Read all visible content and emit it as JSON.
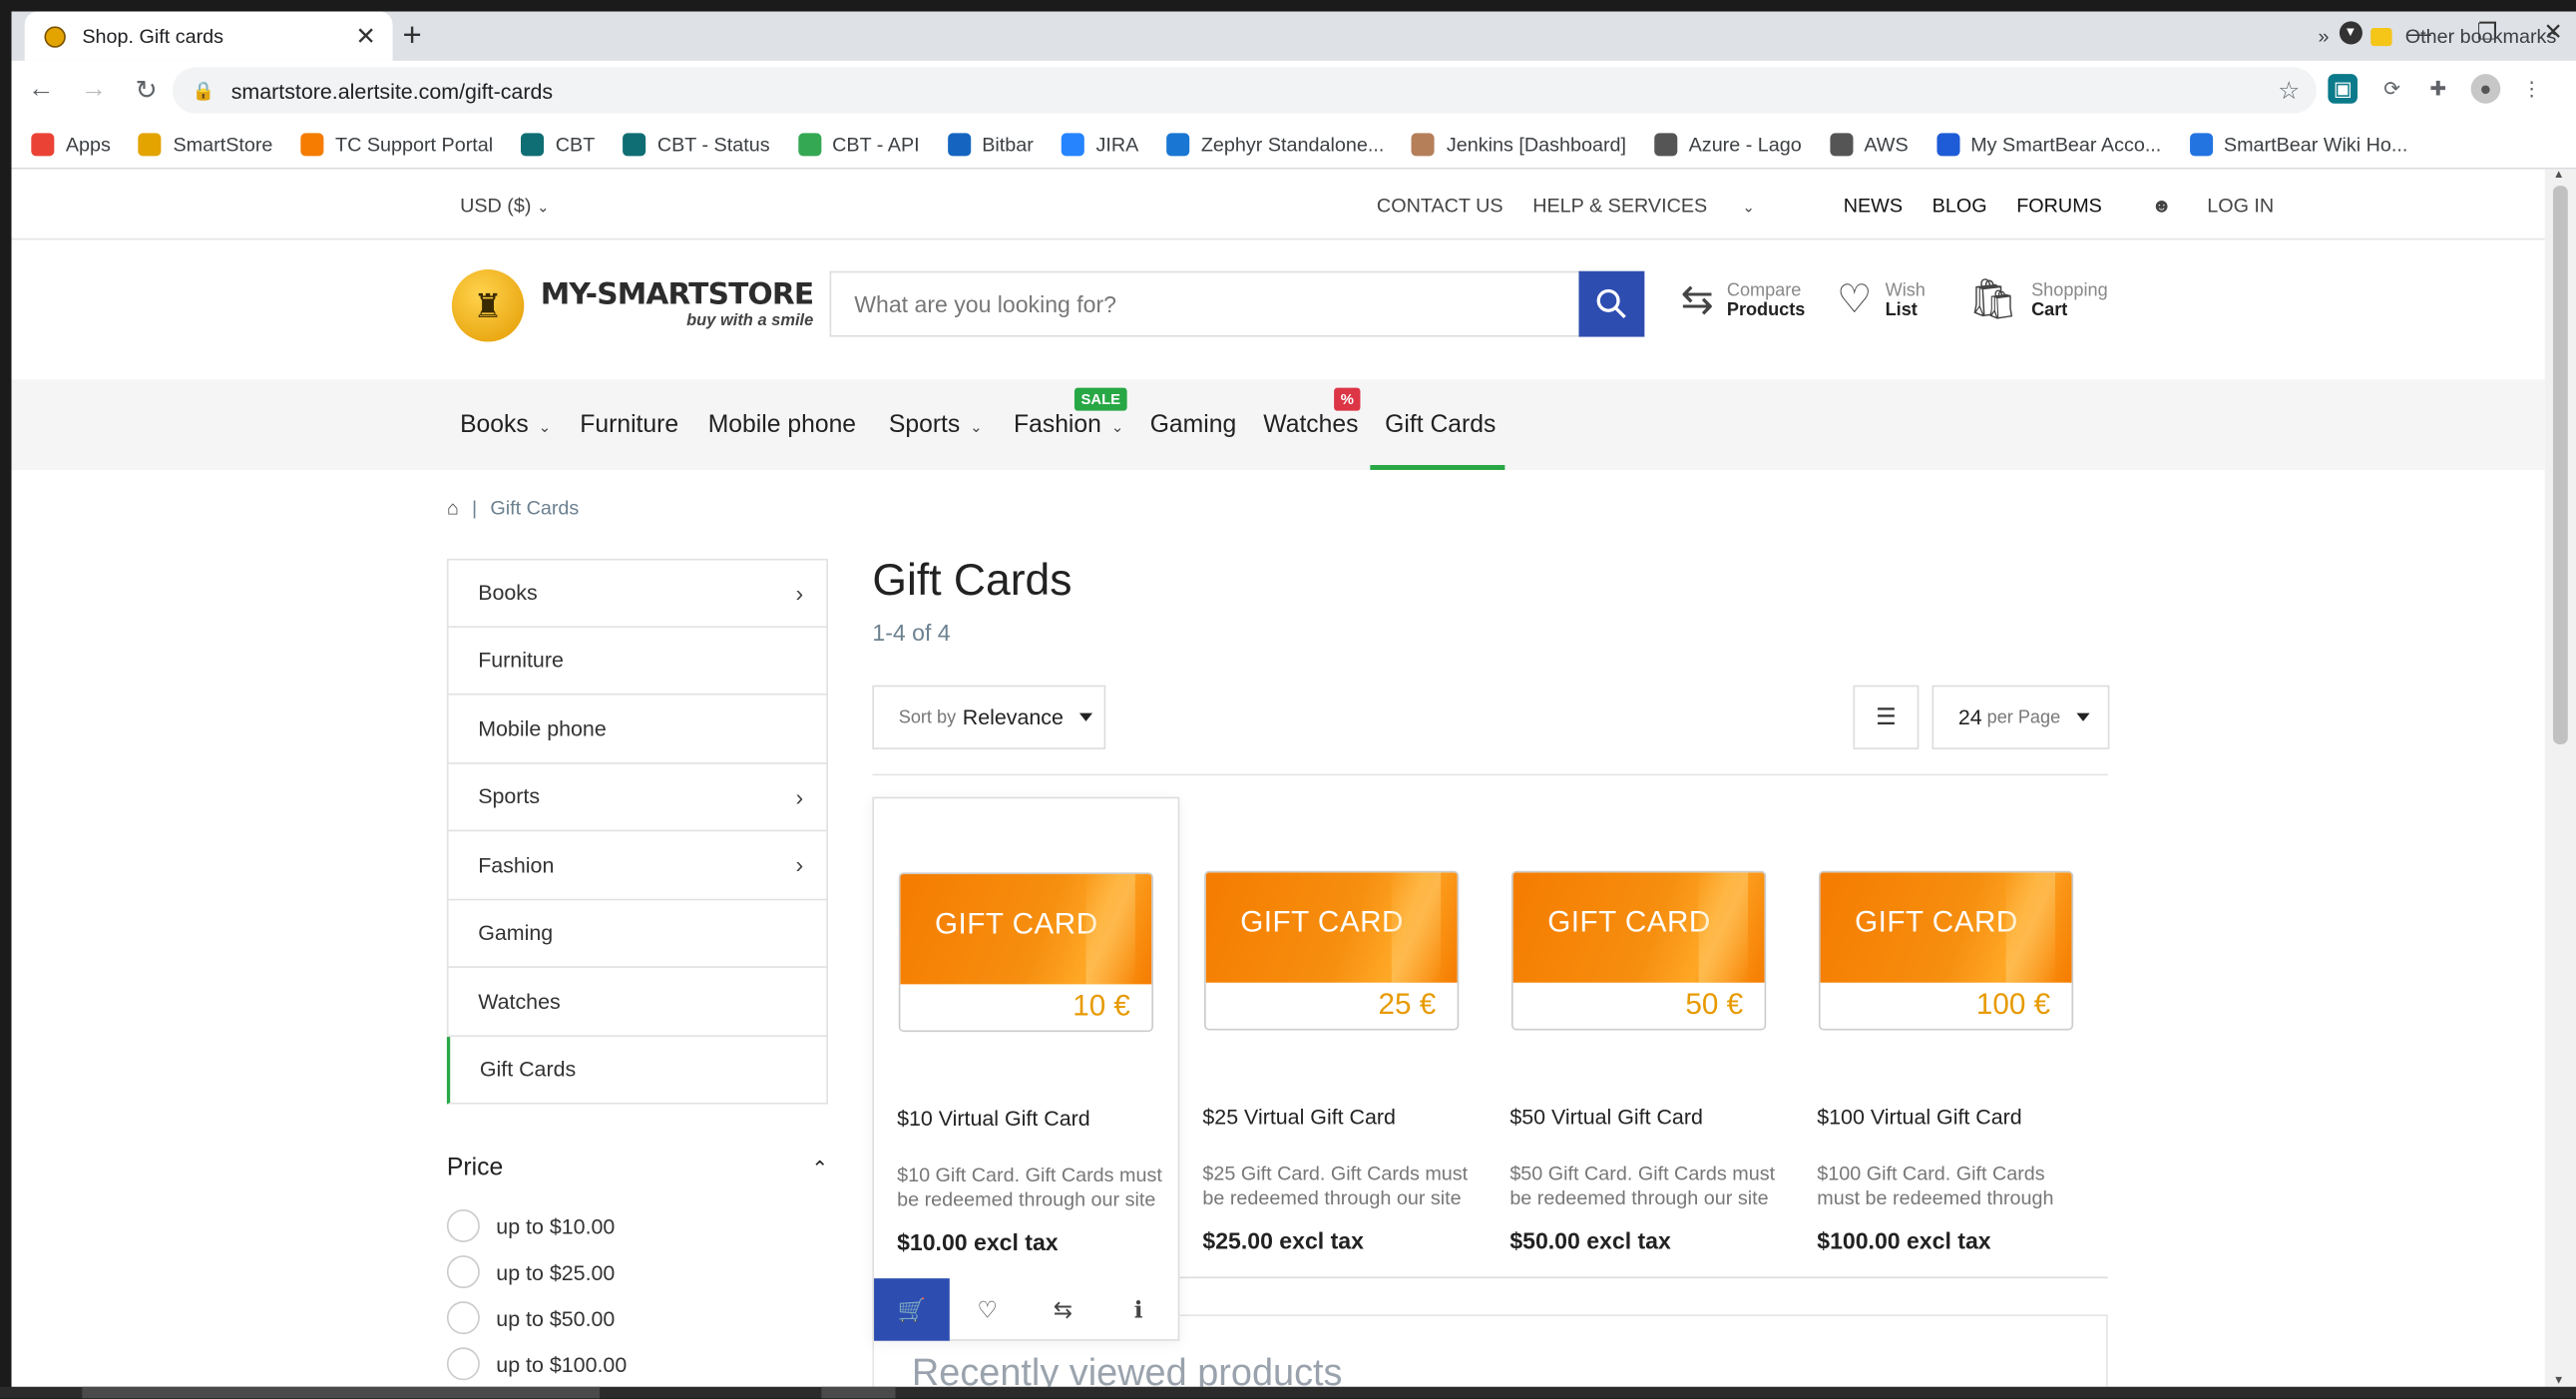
{
  "browser": {
    "tab_title": "Shop. Gift cards",
    "tab_close": "✕",
    "new_tab": "+",
    "url": "smartstore.alertsite.com/gift-cards",
    "bookmarks": [
      {
        "label": "Apps",
        "color": "#ea4335"
      },
      {
        "label": "SmartStore",
        "color": "#e3a400"
      },
      {
        "label": "TC Support Portal",
        "color": "#f57c00"
      },
      {
        "label": "CBT",
        "color": "#0f6e73"
      },
      {
        "label": "CBT - Status",
        "color": "#0f6e73"
      },
      {
        "label": "CBT - API",
        "color": "#34a853"
      },
      {
        "label": "Bitbar",
        "color": "#1565c0"
      },
      {
        "label": "JIRA",
        "color": "#2684ff"
      },
      {
        "label": "Zephyr Standalone...",
        "color": "#1976d2"
      },
      {
        "label": "Jenkins [Dashboard]",
        "color": "#b57f5a"
      },
      {
        "label": "Azure - Lago",
        "color": "#555555"
      },
      {
        "label": "AWS",
        "color": "#555555"
      },
      {
        "label": "My SmartBear Acco...",
        "color": "#1e5bd7"
      },
      {
        "label": "SmartBear Wiki Ho...",
        "color": "#2374e1"
      }
    ],
    "bookmarks_more": "»",
    "other_bookmarks": "Other bookmarks"
  },
  "topbar": {
    "currency": "USD ($)",
    "contact": "CONTACT US",
    "help": "HELP & SERVICES",
    "news": "NEWS",
    "blog": "BLOG",
    "forums": "FORUMS",
    "login": "LOG IN"
  },
  "header": {
    "logo_name": "MY-SMARTSTORE",
    "logo_tag": "buy with a smile",
    "search_placeholder": "What are you looking for?",
    "compare_1": "Compare",
    "compare_2": "Products",
    "wish_1": "Wish",
    "wish_2": "List",
    "cart_1": "Shopping",
    "cart_2": "Cart"
  },
  "nav": {
    "items": [
      "Books",
      "Furniture",
      "Mobile phone",
      "Sports",
      "Fashion",
      "Gaming",
      "Watches",
      "Gift Cards"
    ],
    "sale_badge": "SALE",
    "pct_badge": "%",
    "accent": "#28a745"
  },
  "breadcrumb": {
    "sep": "|",
    "current": "Gift Cards"
  },
  "sidebar": {
    "items": [
      "Books",
      "Furniture",
      "Mobile phone",
      "Sports",
      "Fashion",
      "Gaming",
      "Watches",
      "Gift Cards"
    ],
    "price_title": "Price",
    "price_options": [
      "up to $10.00",
      "up to $25.00",
      "up to $50.00",
      "up to $100.00"
    ]
  },
  "content": {
    "title": "Gift Cards",
    "count": "1-4 of 4",
    "sort_label": "Sort by",
    "sort_value": "Relevance",
    "per_page_value": "24",
    "per_page_label": "per Page",
    "recently_viewed": "Recently viewed products"
  },
  "products": [
    {
      "card_label": "GIFT CARD",
      "amount": "10 €",
      "name": "$10 Virtual Gift Card",
      "desc": "$10 Gift Card. Gift Cards must be redeemed through our site",
      "price": "$10.00 excl tax"
    },
    {
      "card_label": "GIFT CARD",
      "amount": "25 €",
      "name": "$25 Virtual Gift Card",
      "desc": "$25 Gift Card. Gift Cards must be redeemed through our site",
      "price": "$25.00 excl tax"
    },
    {
      "card_label": "GIFT CARD",
      "amount": "50 €",
      "name": "$50 Virtual Gift Card",
      "desc": "$50 Gift Card. Gift Cards must be redeemed through our site",
      "price": "$50.00 excl tax"
    },
    {
      "card_label": "GIFT CARD",
      "amount": "100 €",
      "name": "$100 Virtual Gift Card",
      "desc": "$100 Gift Card. Gift Cards must be redeemed through",
      "price": "$100.00 excl tax"
    }
  ],
  "colors": {
    "primary": "#2e4db1",
    "giftcard": "#f57c00"
  }
}
